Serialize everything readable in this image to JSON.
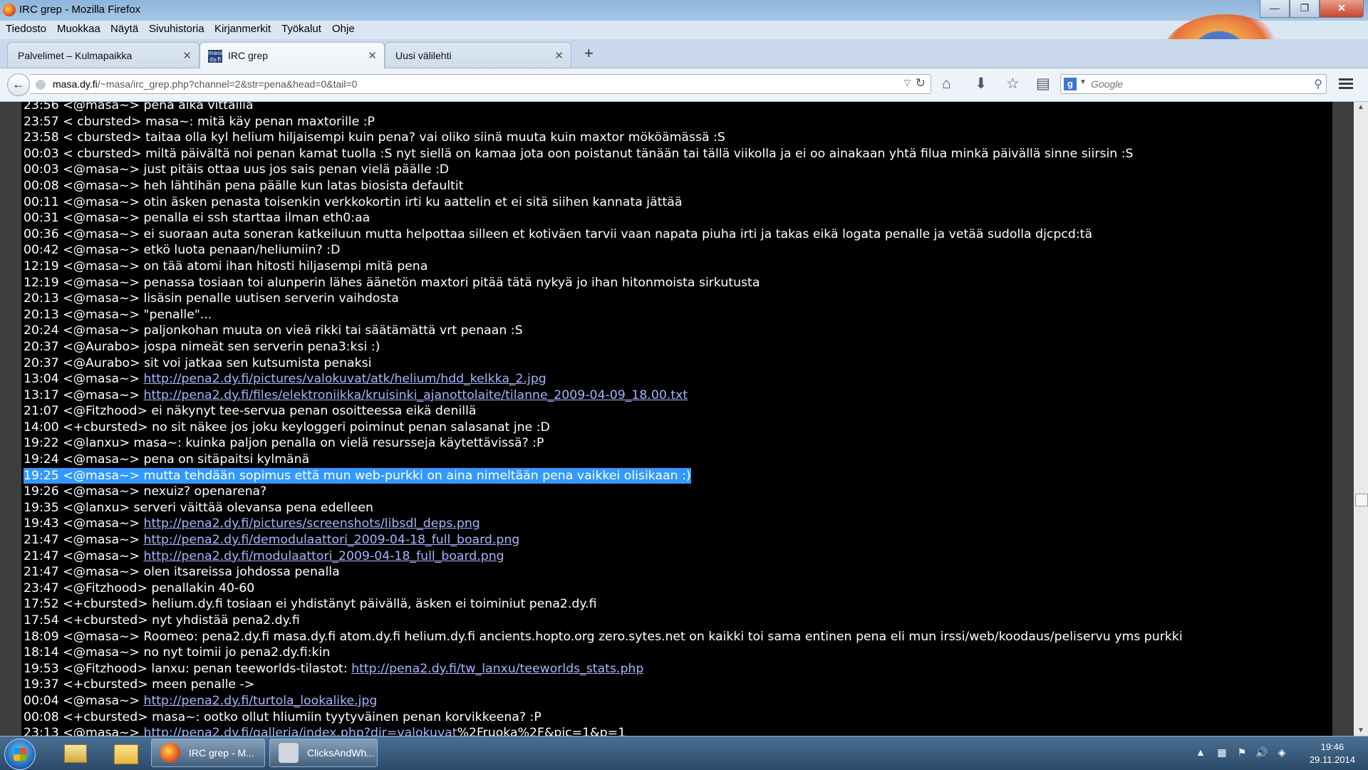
{
  "window": {
    "title": "IRC grep - Mozilla Firefox",
    "minimize": "—",
    "maximize": "❐",
    "close": "✕"
  },
  "menubar": [
    "Tiedosto",
    "Muokkaa",
    "Näytä",
    "Sivuhistoria",
    "Kirjanmerkit",
    "Työkalut",
    "Ohje"
  ],
  "tabs": [
    {
      "label": "Palvelimet – Kulmapaikka",
      "close": "✕"
    },
    {
      "label": "IRC grep",
      "close": "✕",
      "favicon": "masa dy.fi"
    },
    {
      "label": "Uusi välilehti",
      "close": "✕"
    }
  ],
  "new_tab": "+",
  "nav": {
    "url_host": "masa.dy.fi",
    "url_path": "/~masa/irc_grep.php?channel=2&str=pena&head=0&tail=0",
    "search_placeholder": "Google",
    "search_engine_letter": "g"
  },
  "log": {
    "lines": [
      {
        "t": "23:56 <@masa~> pena aika vittailia"
      },
      {
        "t": "23:57 < cbursted> masa~: mitä käy penan maxtorille :P"
      },
      {
        "t": "23:58 < cbursted> taitaa olla kyl helium hiljaisempi kuin pena? vai oliko siinä muuta kuin maxtor mököämässä :S"
      },
      {
        "t": "00:03 < cbursted> miltä päivältä noi penan kamat tuolla :S nyt siellä on kamaa jota oon poistanut tänään tai tällä viikolla ja ei oo ainakaan yhtä filua minkä päivällä sinne siirsin :S"
      },
      {
        "t": "00:03 <@masa~> just pitäis ottaa uus jos sais penan vielä päälle :D"
      },
      {
        "t": "00:08 <@masa~> heh lähtihän pena päälle kun latas biosista defaultit"
      },
      {
        "t": "00:11 <@masa~> otin äsken penasta toisenkin verkkokortin irti ku aattelin et ei sitä siihen kannata jättää"
      },
      {
        "t": "00:31 <@masa~> penalla ei ssh starttaa ilman eth0:aa"
      },
      {
        "t": "00:36 <@masa~> ei suoraan auta soneran katkeiluun mutta helpottaa silleen et kotiväen tarvii vaan napata piuha irti ja takas eikä logata penalle ja vetää sudolla djcpcd:tä"
      },
      {
        "t": "00:42 <@masa~> etkö luota penaan/heliumiin? :D"
      },
      {
        "t": "12:19 <@masa~> on tää atomi ihan hitosti hiljasempi mitä pena"
      },
      {
        "t": "12:19 <@masa~> penassa tosiaan toi alunperin lähes äänetön maxtori pitää tätä nykyä jo ihan hitonmoista sirkutusta"
      },
      {
        "t": "20:13 <@masa~> lisäsin penalle uutisen serverin vaihdosta"
      },
      {
        "t": "20:13 <@masa~> \"penalle\"..."
      },
      {
        "t": "20:24 <@masa~> paljonkohan muuta on vieä rikki tai säätämättä vrt penaan :S"
      },
      {
        "t": "20:37 <@Aurabo> jospa nimeät sen serverin pena3:ksi :)"
      },
      {
        "t": "20:37 <@Aurabo> sit voi jatkaa sen kutsumista penaksi"
      },
      {
        "t": "13:04 <@masa~> ",
        "link": "http://pena2.dy.fi/pictures/valokuvat/atk/helium/hdd_kelkka_2.jpg"
      },
      {
        "t": "13:17 <@masa~> ",
        "link": "http://pena2.dy.fi/files/elektroniikka/kruisinki_ajanottolaite/tilanne_2009-04-09_18.00.txt"
      },
      {
        "t": "21:07 <@Fitzhood> ei näkynyt tee-servua penan osoitteessa eikä denillä"
      },
      {
        "t": "14:00 <+cbursted> no sit näkee jos joku keyloggeri poiminut penan salasanat jne :D"
      },
      {
        "t": "19:22 <@lanxu> masa~: kuinka paljon penalla on vielä resursseja käytettävissä? :P"
      },
      {
        "t": "19:24 <@masa~> pena on sitäpaitsi kylmänä"
      },
      {
        "t": "19:25 <@masa~> mutta tehdään sopimus että mun web-purkki on aina nimeltään pena vaikkei olisikaan :)",
        "highlight": true
      },
      {
        "t": "19:26 <@masa~> nexuiz? openarena?"
      },
      {
        "t": "19:35 <@lanxu> serveri väittää olevansa pena edelleen"
      },
      {
        "t": "19:43 <@masa~> ",
        "link": "http://pena2.dy.fi/pictures/screenshots/libsdl_deps.png"
      },
      {
        "t": "21:47 <@masa~> ",
        "link": "http://pena2.dy.fi/demodulaattori_2009-04-18_full_board.png"
      },
      {
        "t": "21:47 <@masa~> ",
        "link": "http://pena2.dy.fi/modulaattori_2009-04-18_full_board.png"
      },
      {
        "t": "21:47 <@masa~> olen itsareissa johdossa penalla"
      },
      {
        "t": "23:47 <@Fitzhood> penallakin 40-60"
      },
      {
        "t": "17:52 <+cbursted> helium.dy.fi tosiaan ei yhdistänyt päivällä, äsken ei toiminiut pena2.dy.fi"
      },
      {
        "t": "17:54 <+cbursted> nyt yhdistää pena2.dy.fi"
      },
      {
        "t": "18:09 <@masa~> Roomeo: pena2.dy.fi masa.dy.fi atom.dy.fi helium.dy.fi ancients.hopto.org zero.sytes.net on kaikki toi sama entinen pena eli mun irssi/web/koodaus/peliservu yms purkki"
      },
      {
        "t": "18:14 <@masa~> no nyt toimii jo pena2.dy.fi:kin"
      },
      {
        "t": "19:53 <@Fitzhood> lanxu: penan teeworlds-tilastot: ",
        "link": "http://pena2.dy.fi/tw_lanxu/teeworlds_stats.php"
      },
      {
        "t": "19:37 <+cbursted> meen penalle ->"
      },
      {
        "t": "00:04 <@masa~> ",
        "link": "http://pena2.dy.fi/turtola_lookalike.jpg"
      },
      {
        "t": "00:08 <+cbursted> masa~: ootko ollut hliumiin tyytyväinen penan korvikkeena? :P"
      },
      {
        "t": "23:13 <@masa~> ",
        "link": "http://pena2.dy.fi/galleria/index.php?dir=valokuvat",
        "after": "%2Fruoka%2F&pic=1&p=1"
      }
    ]
  },
  "taskbar": {
    "tasks": [
      {
        "label": "IRC grep - M..."
      },
      {
        "label": "ClicksAndWh..."
      }
    ],
    "clock_time": "19:46",
    "clock_date": "29.11.2014",
    "tray_arrow": "▲"
  },
  "colors": {
    "log_bg": "#000000",
    "log_text": "#ffffff",
    "link": "#aab2ff",
    "highlight": "#3399ff"
  }
}
